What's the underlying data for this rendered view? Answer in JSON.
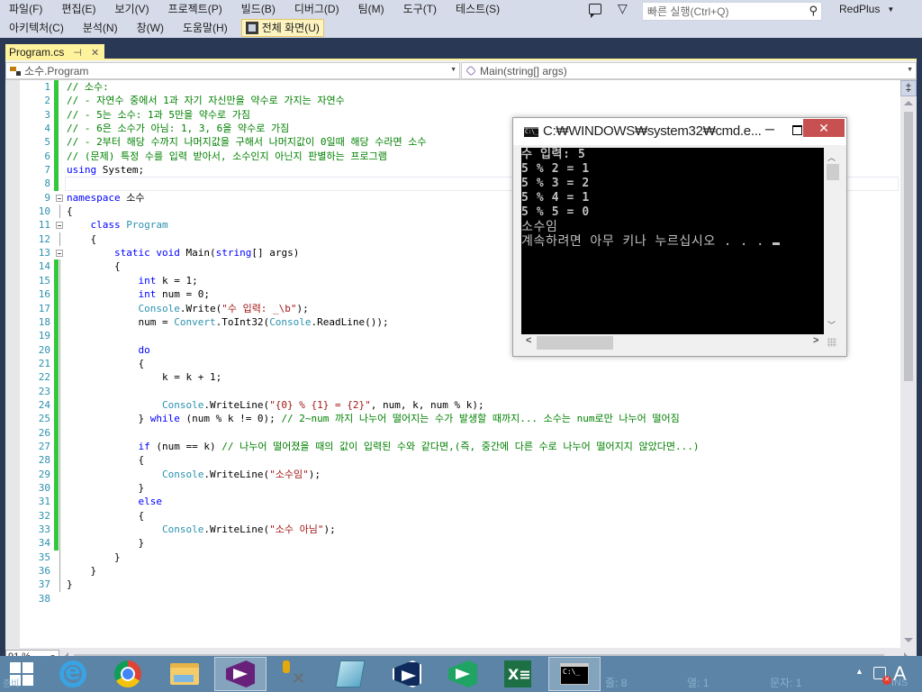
{
  "menubar": {
    "row1": [
      "파일(F)",
      "편집(E)",
      "보기(V)",
      "프로젝트(P)",
      "빌드(B)",
      "디버그(D)",
      "팀(M)",
      "도구(T)",
      "테스트(S)"
    ],
    "row2": [
      "아키텍처(C)",
      "분석(N)",
      "창(W)",
      "도움말(H)"
    ],
    "fullscreen_label": "전체 화면(U)",
    "quick_launch_placeholder": "빠른 실행(Ctrl+Q)",
    "user": "RedPlus"
  },
  "tabs": [
    {
      "label": "Program.cs",
      "active": true
    }
  ],
  "navbar": {
    "class_combo": "소수.Program",
    "member_combo": "Main(string[] args)"
  },
  "editor": {
    "lines": [
      {
        "n": "1",
        "chg": true,
        "parts": [
          [
            "cm",
            "// 소수:"
          ]
        ]
      },
      {
        "n": "2",
        "chg": true,
        "parts": [
          [
            "cm",
            "// - 자연수 중에서 1과 자기 자신만을 약수로 가지는 자연수"
          ]
        ]
      },
      {
        "n": "3",
        "chg": true,
        "parts": [
          [
            "cm",
            "// - 5는 소수: 1과 5만을 약수로 가짐"
          ]
        ]
      },
      {
        "n": "4",
        "chg": true,
        "parts": [
          [
            "cm",
            "// - 6은 소수가 아님: 1, 3, 6을 약수로 가짐"
          ]
        ]
      },
      {
        "n": "5",
        "chg": true,
        "parts": [
          [
            "cm",
            "// - 2부터 해당 수까지 나머지값을 구해서 나머지값이 0일때 해당 수라면 소수"
          ]
        ]
      },
      {
        "n": "6",
        "chg": true,
        "parts": [
          [
            "cm",
            "// (문제) 특정 수를 입력 받아서, 소수인지 아닌지 판별하는 프로그램"
          ]
        ]
      },
      {
        "n": "7",
        "chg": true,
        "parts": [
          [
            "kw",
            "using"
          ],
          [
            "pl",
            " System;"
          ]
        ]
      },
      {
        "n": "8",
        "chg": true,
        "current": true,
        "parts": []
      },
      {
        "n": "9",
        "fold": true,
        "parts": [
          [
            "kw",
            "namespace"
          ],
          [
            "pl",
            " 소수"
          ]
        ]
      },
      {
        "n": "10",
        "guide": true,
        "parts": [
          [
            "pl",
            "{"
          ]
        ]
      },
      {
        "n": "11",
        "fold": true,
        "parts": [
          [
            "pl",
            "    "
          ],
          [
            "kw",
            "class"
          ],
          [
            "pl",
            " "
          ],
          [
            "ty",
            "Program"
          ]
        ]
      },
      {
        "n": "12",
        "guide": true,
        "parts": [
          [
            "pl",
            "    {"
          ]
        ]
      },
      {
        "n": "13",
        "fold": true,
        "parts": [
          [
            "pl",
            "        "
          ],
          [
            "kw",
            "static"
          ],
          [
            "pl",
            " "
          ],
          [
            "kw",
            "void"
          ],
          [
            "pl",
            " Main("
          ],
          [
            "kw",
            "string"
          ],
          [
            "pl",
            "[] args)"
          ]
        ]
      },
      {
        "n": "14",
        "chg": true,
        "guide": true,
        "parts": [
          [
            "pl",
            "        {"
          ]
        ]
      },
      {
        "n": "15",
        "chg": true,
        "guide": true,
        "parts": [
          [
            "pl",
            "            "
          ],
          [
            "kw",
            "int"
          ],
          [
            "pl",
            " k = 1;"
          ]
        ]
      },
      {
        "n": "16",
        "chg": true,
        "guide": true,
        "parts": [
          [
            "pl",
            "            "
          ],
          [
            "kw",
            "int"
          ],
          [
            "pl",
            " num = 0;"
          ]
        ]
      },
      {
        "n": "17",
        "chg": true,
        "guide": true,
        "parts": [
          [
            "pl",
            "            "
          ],
          [
            "ty",
            "Console"
          ],
          [
            "pl",
            ".Write("
          ],
          [
            "st",
            "\"수 입력: _\\b\""
          ],
          [
            "pl",
            ");"
          ]
        ]
      },
      {
        "n": "18",
        "chg": true,
        "guide": true,
        "parts": [
          [
            "pl",
            "            num = "
          ],
          [
            "ty",
            "Convert"
          ],
          [
            "pl",
            ".ToInt32("
          ],
          [
            "ty",
            "Console"
          ],
          [
            "pl",
            ".ReadLine());"
          ]
        ]
      },
      {
        "n": "19",
        "chg": true,
        "guide": true,
        "parts": []
      },
      {
        "n": "20",
        "chg": true,
        "guide": true,
        "parts": [
          [
            "pl",
            "            "
          ],
          [
            "kw",
            "do"
          ]
        ]
      },
      {
        "n": "21",
        "chg": true,
        "guide": true,
        "parts": [
          [
            "pl",
            "            {"
          ]
        ]
      },
      {
        "n": "22",
        "chg": true,
        "guide": true,
        "parts": [
          [
            "pl",
            "                k = k + 1;"
          ]
        ]
      },
      {
        "n": "23",
        "chg": true,
        "guide": true,
        "parts": []
      },
      {
        "n": "24",
        "chg": true,
        "guide": true,
        "parts": [
          [
            "pl",
            "                "
          ],
          [
            "ty",
            "Console"
          ],
          [
            "pl",
            ".WriteLine("
          ],
          [
            "st",
            "\"{0} % {1} = {2}\""
          ],
          [
            "pl",
            ", num, k, num % k);"
          ]
        ]
      },
      {
        "n": "25",
        "chg": true,
        "guide": true,
        "parts": [
          [
            "pl",
            "            } "
          ],
          [
            "kw",
            "while"
          ],
          [
            "pl",
            " (num % k != 0); "
          ],
          [
            "cm",
            "// 2~num 까지 나누어 떨어지는 수가 발생할 때까지... 소수는 num로만 나누어 떨어짐"
          ]
        ]
      },
      {
        "n": "26",
        "chg": true,
        "guide": true,
        "parts": []
      },
      {
        "n": "27",
        "chg": true,
        "guide": true,
        "parts": [
          [
            "pl",
            "            "
          ],
          [
            "kw",
            "if"
          ],
          [
            "pl",
            " (num == k) "
          ],
          [
            "cm",
            "// 나누어 떨어졌을 때의 값이 입력된 수와 같다면,(즉, 중간에 다른 수로 나누어 떨어지지 않았다면...)"
          ]
        ]
      },
      {
        "n": "28",
        "chg": true,
        "guide": true,
        "parts": [
          [
            "pl",
            "            {"
          ]
        ]
      },
      {
        "n": "29",
        "chg": true,
        "guide": true,
        "parts": [
          [
            "pl",
            "                "
          ],
          [
            "ty",
            "Console"
          ],
          [
            "pl",
            ".WriteLine("
          ],
          [
            "st",
            "\"소수임\""
          ],
          [
            "pl",
            ");"
          ]
        ]
      },
      {
        "n": "30",
        "chg": true,
        "guide": true,
        "parts": [
          [
            "pl",
            "            }"
          ]
        ]
      },
      {
        "n": "31",
        "chg": true,
        "guide": true,
        "parts": [
          [
            "pl",
            "            "
          ],
          [
            "kw",
            "else"
          ]
        ]
      },
      {
        "n": "32",
        "chg": true,
        "guide": true,
        "parts": [
          [
            "pl",
            "            {"
          ]
        ]
      },
      {
        "n": "33",
        "chg": true,
        "guide": true,
        "parts": [
          [
            "pl",
            "                "
          ],
          [
            "ty",
            "Console"
          ],
          [
            "pl",
            ".WriteLine("
          ],
          [
            "st",
            "\"소수 아님\""
          ],
          [
            "pl",
            ");"
          ]
        ]
      },
      {
        "n": "34",
        "chg": true,
        "guide": true,
        "parts": [
          [
            "pl",
            "            }"
          ]
        ]
      },
      {
        "n": "35",
        "guide": true,
        "parts": [
          [
            "pl",
            "        }"
          ]
        ]
      },
      {
        "n": "36",
        "guide": true,
        "parts": [
          [
            "pl",
            "    }"
          ]
        ]
      },
      {
        "n": "37",
        "guide": true,
        "parts": [
          [
            "pl",
            "}"
          ]
        ]
      },
      {
        "n": "38",
        "parts": []
      }
    ]
  },
  "zoom_level": "91 %",
  "console": {
    "title": "C:₩WINDOWS₩system32₩cmd.e...",
    "lines": [
      {
        "text": "수 입력: 5",
        "thin": false
      },
      {
        "text": "5 % 2 = 1",
        "thin": false
      },
      {
        "text": "5 % 3 = 2",
        "thin": false
      },
      {
        "text": "5 % 4 = 1",
        "thin": false
      },
      {
        "text": "5 % 5 = 0",
        "thin": false
      },
      {
        "text": "소수임",
        "thin": true
      },
      {
        "text": "계속하려면 아무 키나 누르십시오 . . . ",
        "thin": true,
        "cursor": true
      }
    ]
  },
  "statusbar": {
    "start_label": "준비",
    "line": "줄: 8",
    "col": "열: 1",
    "char": "문자: 1",
    "mode": "INS"
  },
  "taskbar": {
    "items": [
      "start",
      "internet-explorer",
      "chrome",
      "file-explorer",
      "visual-studio",
      "db-tools",
      "notepad",
      "vs-code-dark",
      "vs-green",
      "excel",
      "command-prompt"
    ]
  }
}
